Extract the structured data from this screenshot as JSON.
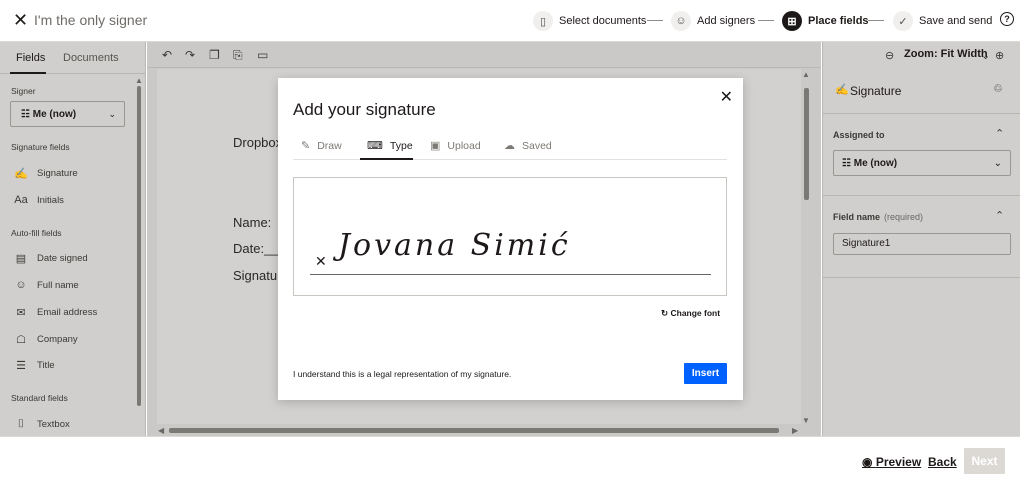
{
  "topbar": {
    "close_icon": "close-icon",
    "title": "I'm the only signer",
    "steps": [
      {
        "label": "Select documents",
        "icon": "document-icon",
        "active": false
      },
      {
        "label": "Add signers",
        "icon": "add-user-icon",
        "active": false
      },
      {
        "label": "Place fields",
        "icon": "place-fields-icon",
        "active": true
      },
      {
        "label": "Save and send",
        "icon": "check-icon",
        "active": false
      }
    ],
    "help_icon": "help-icon"
  },
  "left_panel": {
    "tabs": [
      "Fields",
      "Documents"
    ],
    "signer_label": "Signer",
    "signer_value": "Me (now)",
    "signature_fields_label": "Signature fields",
    "signature_fields": [
      {
        "label": "Signature",
        "icon": "signature-icon"
      },
      {
        "label": "Initials",
        "icon": "initials-icon"
      }
    ],
    "autofill_label": "Auto-fill fields",
    "autofill_fields": [
      {
        "label": "Date signed",
        "icon": "calendar-icon"
      },
      {
        "label": "Full name",
        "icon": "person-icon"
      },
      {
        "label": "Email address",
        "icon": "email-icon"
      },
      {
        "label": "Company",
        "icon": "building-icon"
      },
      {
        "label": "Title",
        "icon": "title-icon"
      }
    ],
    "standard_label": "Standard fields",
    "standard_fields": [
      {
        "label": "Textbox",
        "icon": "textbox-icon"
      }
    ]
  },
  "document": {
    "line1": "Dropbox",
    "line2": "Name:",
    "line3": "Date:__",
    "line4": "Signatur"
  },
  "right_panel": {
    "zoom_label": "Zoom: Fit Width",
    "field_type": "Signature",
    "assigned_to_label": "Assigned to",
    "assigned_to_value": "Me (now)",
    "field_name_label": "Field name",
    "field_name_required": "(required)",
    "field_name_value": "Signature1"
  },
  "bottombar": {
    "preview_label": "Preview",
    "back_label": "Back",
    "next_label": "Next"
  },
  "modal": {
    "title": "Add your signature",
    "tabs": [
      {
        "label": "Draw",
        "icon": "draw-icon",
        "active": false
      },
      {
        "label": "Type",
        "icon": "keyboard-icon",
        "active": true
      },
      {
        "label": "Upload",
        "icon": "upload-icon",
        "active": false
      },
      {
        "label": "Saved",
        "icon": "cloud-icon",
        "active": false
      }
    ],
    "signature_text": "Jovana Simić",
    "change_font_label": "Change font",
    "legal_text": "I understand this is a legal representation of my signature.",
    "insert_label": "Insert"
  }
}
